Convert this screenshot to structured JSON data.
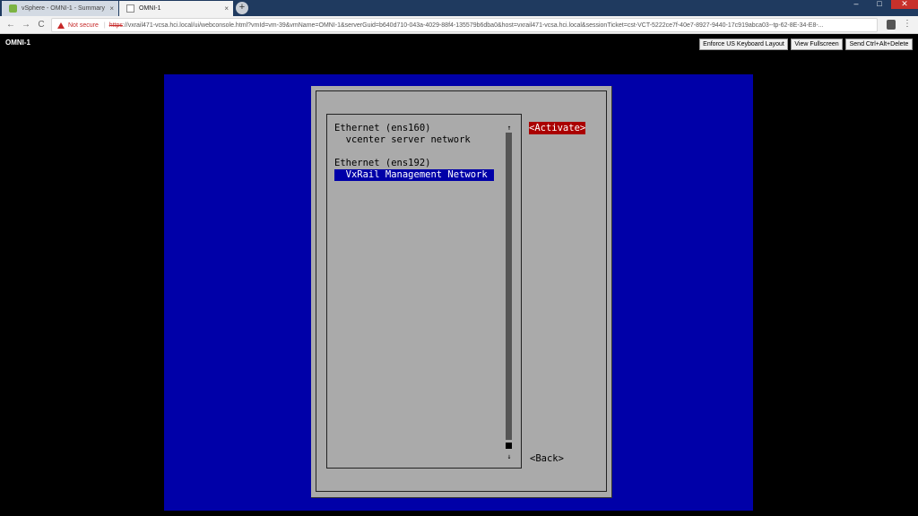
{
  "browser": {
    "tabs": [
      {
        "title": "vSphere - OMNI-1 - Summary",
        "active": false,
        "icon": "vsphere-icon"
      },
      {
        "title": "OMNI-1",
        "active": true,
        "icon": "page-icon"
      }
    ],
    "new_tab": "+",
    "close_glyph": "×",
    "window_controls": {
      "minimize": "–",
      "maximize": "□",
      "close": "✕"
    },
    "nav": {
      "back": "←",
      "forward": "→",
      "reload": "C"
    },
    "address": {
      "security": "Not secure",
      "scheme": "https",
      "url_rest": "://vxrail471-vcsa.hci.local/ui/webconsole.html?vmId=vm-39&vmName=OMNI-1&serverGuid=b640d710-043a-4029-88f4-135579b6dba0&host=vxrail471-vcsa.hci.local&sessionTicket=cst-VCT-5222ce7f-40e7-8927-9440-17c919abca03--tp-62-8E-34-E8-..."
    },
    "menu_glyph": "⋮"
  },
  "console": {
    "title": "OMNI-1",
    "buttons": {
      "keyboard": "Enforce US Keyboard Layout",
      "fullscreen": "View Fullscreen",
      "ctrl_alt_del": "Send Ctrl+Alt+Delete"
    }
  },
  "tui": {
    "list": [
      {
        "text": "Ethernet (ens160)",
        "selected": false
      },
      {
        "text": "  vcenter server network",
        "selected": false
      },
      {
        "text": "Ethernet (ens192)",
        "selected": false
      },
      {
        "text": "  VxRail Management Network",
        "selected": true
      }
    ],
    "scroll_up": "↑",
    "scroll_down": "↓",
    "activate_label": "<Activate>",
    "back_label": "<Back>"
  },
  "colors": {
    "console_blue": "#0000a8",
    "dialog_gray": "#aaaaaa",
    "activate_red": "#aa0000",
    "warning_red": "#c62828"
  }
}
